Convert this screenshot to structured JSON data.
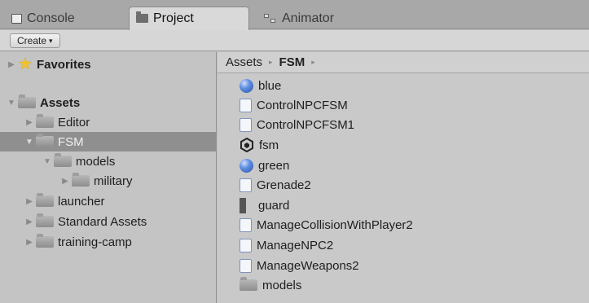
{
  "tabs": [
    {
      "label": "Console",
      "icon": "console-icon"
    },
    {
      "label": "Project",
      "icon": "folder-icon",
      "active": true
    },
    {
      "label": "Animator",
      "icon": "animator-icon"
    }
  ],
  "toolbar": {
    "create_label": "Create",
    "create_caret": "▾"
  },
  "tree": {
    "favorites": "Favorites",
    "assets": "Assets",
    "editor": "Editor",
    "fsm": "FSM",
    "models": "models",
    "military": "military",
    "launcher": "launcher",
    "standard_assets": "Standard Assets",
    "training_camp": "training-camp"
  },
  "breadcrumb": {
    "root": "Assets",
    "sep": "▸",
    "current": "FSM"
  },
  "assets": [
    {
      "name": "blue",
      "type": "material"
    },
    {
      "name": "ControlNPCFSM",
      "type": "script"
    },
    {
      "name": "ControlNPCFSM1",
      "type": "script"
    },
    {
      "name": "fsm",
      "type": "scene"
    },
    {
      "name": "green",
      "type": "material"
    },
    {
      "name": "Grenade2",
      "type": "script"
    },
    {
      "name": "guard",
      "type": "prefab"
    },
    {
      "name": "ManageCollisionWithPlayer2",
      "type": "script"
    },
    {
      "name": "ManageNPC2",
      "type": "script"
    },
    {
      "name": "ManageWeapons2",
      "type": "script"
    },
    {
      "name": "models",
      "type": "folder"
    }
  ],
  "colors": {
    "selection": "#8f8f8f",
    "material_blue": "#3e6fcf",
    "script_blue": "#3e7bd1"
  }
}
